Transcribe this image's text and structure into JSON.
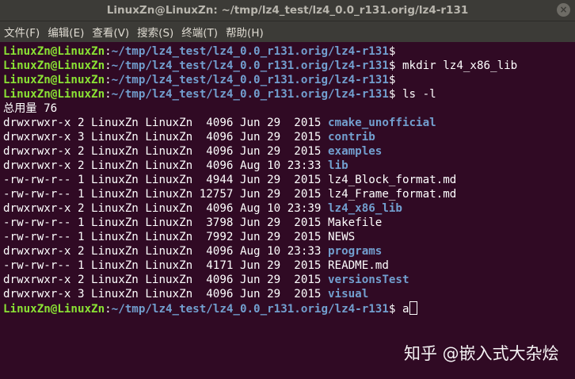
{
  "window": {
    "title": "LinuxZn@LinuxZn: ~/tmp/lz4_test/lz4_0.0_r131.orig/lz4-r131",
    "close_glyph": "×"
  },
  "menu": {
    "items": [
      "文件(F)",
      "编辑(E)",
      "查看(V)",
      "搜索(S)",
      "终端(T)",
      "帮助(H)"
    ]
  },
  "prompt": {
    "user": "LinuxZn@LinuxZn",
    "sep": ":",
    "path": "~/tmp/lz4_test/lz4_0.0_r131.orig/lz4-r131",
    "symbol": "$"
  },
  "commands": [
    "",
    "mkdir lz4_x86_lib",
    "",
    "ls -l"
  ],
  "total": "总用量 76",
  "listing": [
    {
      "meta": "drwxrwxr-x 2 LinuxZn LinuxZn  4096 Jun 29  2015 ",
      "name": "cmake_unofficial",
      "dir": true
    },
    {
      "meta": "drwxrwxr-x 3 LinuxZn LinuxZn  4096 Jun 29  2015 ",
      "name": "contrib",
      "dir": true
    },
    {
      "meta": "drwxrwxr-x 2 LinuxZn LinuxZn  4096 Jun 29  2015 ",
      "name": "examples",
      "dir": true
    },
    {
      "meta": "drwxrwxr-x 2 LinuxZn LinuxZn  4096 Aug 10 23:33 ",
      "name": "lib",
      "dir": true
    },
    {
      "meta": "-rw-rw-r-- 1 LinuxZn LinuxZn  4944 Jun 29  2015 ",
      "name": "lz4_Block_format.md",
      "dir": false
    },
    {
      "meta": "-rw-rw-r-- 1 LinuxZn LinuxZn 12757 Jun 29  2015 ",
      "name": "lz4_Frame_format.md",
      "dir": false
    },
    {
      "meta": "drwxrwxr-x 2 LinuxZn LinuxZn  4096 Aug 10 23:39 ",
      "name": "lz4_x86_lib",
      "dir": true
    },
    {
      "meta": "-rw-rw-r-- 1 LinuxZn LinuxZn  3798 Jun 29  2015 ",
      "name": "Makefile",
      "dir": false
    },
    {
      "meta": "-rw-rw-r-- 1 LinuxZn LinuxZn  7992 Jun 29  2015 ",
      "name": "NEWS",
      "dir": false
    },
    {
      "meta": "drwxrwxr-x 2 LinuxZn LinuxZn  4096 Aug 10 23:33 ",
      "name": "programs",
      "dir": true
    },
    {
      "meta": "-rw-rw-r-- 1 LinuxZn LinuxZn  4171 Jun 29  2015 ",
      "name": "README.md",
      "dir": false
    },
    {
      "meta": "drwxrwxr-x 2 LinuxZn LinuxZn  4096 Jun 29  2015 ",
      "name": "versionsTest",
      "dir": true
    },
    {
      "meta": "drwxrwxr-x 3 LinuxZn LinuxZn  4096 Jun 29  2015 ",
      "name": "visual",
      "dir": true
    }
  ],
  "final_input": "a",
  "watermark": "知乎 @嵌入式大杂烩",
  "colors": {
    "background": "#300a24",
    "user": "#8ae234",
    "directory": "#729fcf"
  }
}
